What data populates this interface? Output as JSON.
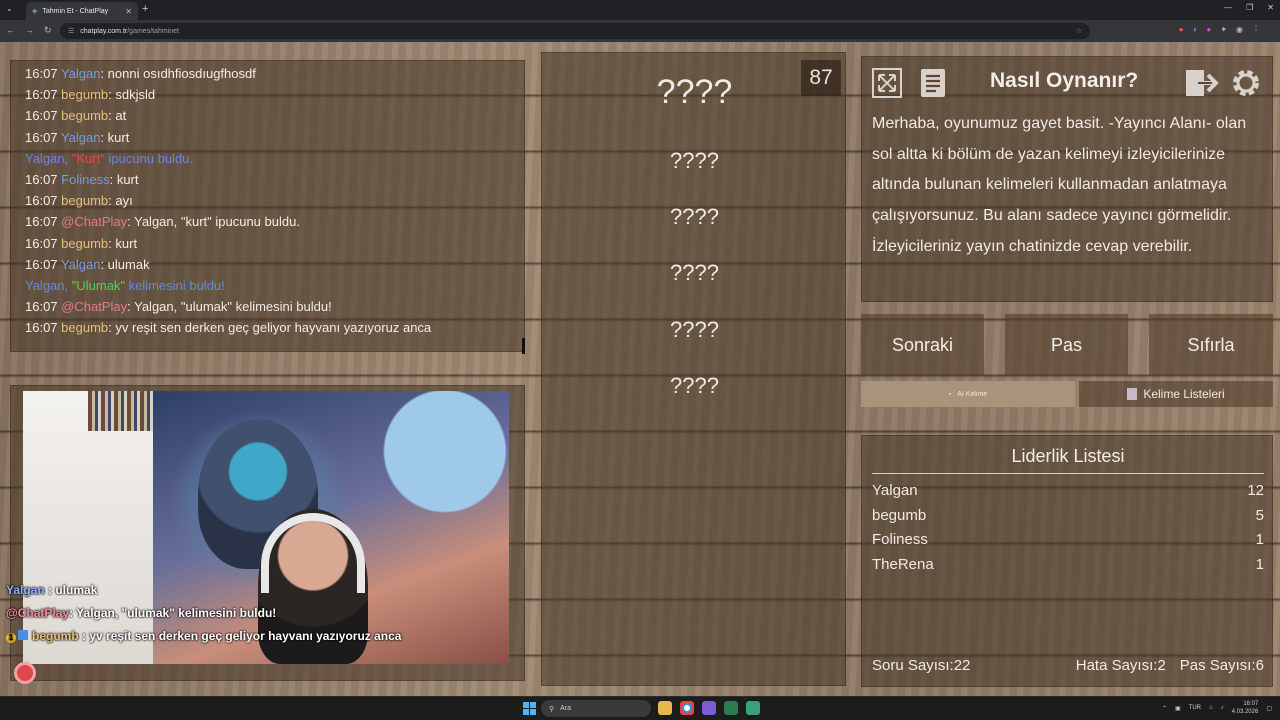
{
  "browser": {
    "tab_title": "Tahmin Et - ChatPlay",
    "url_host": "chatplay.com.tr",
    "url_path": "/games/tahminet"
  },
  "chat": {
    "messages": [
      {
        "time": "16:07",
        "user": "Yalgan",
        "text": ": nonni osıdhfiosdıugfhosdf",
        "color": "blue"
      },
      {
        "time": "16:07",
        "user": "begumb",
        "text": ": sdkjsld",
        "color": "yellow"
      },
      {
        "time": "16:07",
        "user": "begumb",
        "text": ": at",
        "color": "yellow"
      },
      {
        "time": "16:07",
        "user": "Yalgan",
        "text": ": kurt",
        "color": "blue"
      },
      {
        "system": "hint",
        "a": "Yalgan, ",
        "b": "\"Kurt\"",
        "c": " ipucunu buldu."
      },
      {
        "time": "16:07",
        "user": "Foliness",
        "text": ": kurt",
        "color": "blue"
      },
      {
        "time": "16:07",
        "user": "begumb",
        "text": ": ayı",
        "color": "yellow"
      },
      {
        "time": "16:07",
        "user": "@ChatPlay",
        "text": ": Yalgan, \"kurt\" ipucunu buldu.",
        "color": "pink"
      },
      {
        "time": "16:07",
        "user": "begumb",
        "text": ": kurt",
        "color": "yellow"
      },
      {
        "time": "16:07",
        "user": "Yalgan",
        "text": ": ulumak",
        "color": "blue"
      },
      {
        "system": "word",
        "a": "Yalgan, ",
        "b": "\"Ulumak\"",
        "c": " kelimesini buldu!"
      },
      {
        "time": "16:07",
        "user": "@ChatPlay",
        "text": ": Yalgan, \"ulumak\" kelimesini buldu!",
        "color": "pink"
      },
      {
        "time": "16:07",
        "user": "begumb",
        "text": ": yv reşit sen derken geç geliyor hayvanı yazıyoruz anca",
        "color": "yellow"
      }
    ]
  },
  "stream_overlay": [
    {
      "user": "Yalgan",
      "text": " : ulumak",
      "color": "blue"
    },
    {
      "user": "@ChatPlay",
      "text": ": Yalgan, \"ulumak\" kelimesini buldu!",
      "color": "pink"
    },
    {
      "user": "begumb",
      "text": " : yv reşit sen derken geç geliyor hayvanı yazıyoruz anca",
      "color": "gold",
      "badge": "1"
    }
  ],
  "game": {
    "timer": "87",
    "main_word": "????",
    "hints": [
      "????",
      "????",
      "????",
      "????",
      "????"
    ]
  },
  "how_to": {
    "title": "Nasıl Oynanır?",
    "text": "Merhaba, oyunumuz gayet basit. -Yayıncı Alanı- olan sol altta ki bölüm de yazan kelimeyi izleyicilerinize altında bulunan kelimeleri kullanmadan anlatmaya çalışıyorsunuz. Bu alanı sadece yayıncı görmelidir. İzleyicileriniz yayın chatinizde cevap verebilir."
  },
  "controls": {
    "next": "Sonraki",
    "pass": "Pas",
    "reset": "Sıfırla",
    "ai_words": "AI Kelime",
    "word_lists": "Kelime Listeleri"
  },
  "leaderboard": {
    "title": "Liderlik Listesi",
    "rows": [
      {
        "name": "Yalgan",
        "score": "12"
      },
      {
        "name": "begumb",
        "score": "5"
      },
      {
        "name": "Foliness",
        "score": "1"
      },
      {
        "name": "TheRena",
        "score": "1"
      }
    ],
    "question_label": "Soru Sayısı:",
    "question_count": "22",
    "error_label": "Hata Sayısı:",
    "error_count": "2",
    "pass_label": "Pas Sayısı:",
    "pass_count": "6"
  },
  "taskbar": {
    "search_placeholder": "Ara",
    "lang": "TUR",
    "time": "16:07",
    "date": "4.03.2026"
  },
  "colors": {
    "user_blue": "#7a9ad8",
    "user_yellow": "#e4c07a",
    "user_pink": "#e07c8b"
  }
}
